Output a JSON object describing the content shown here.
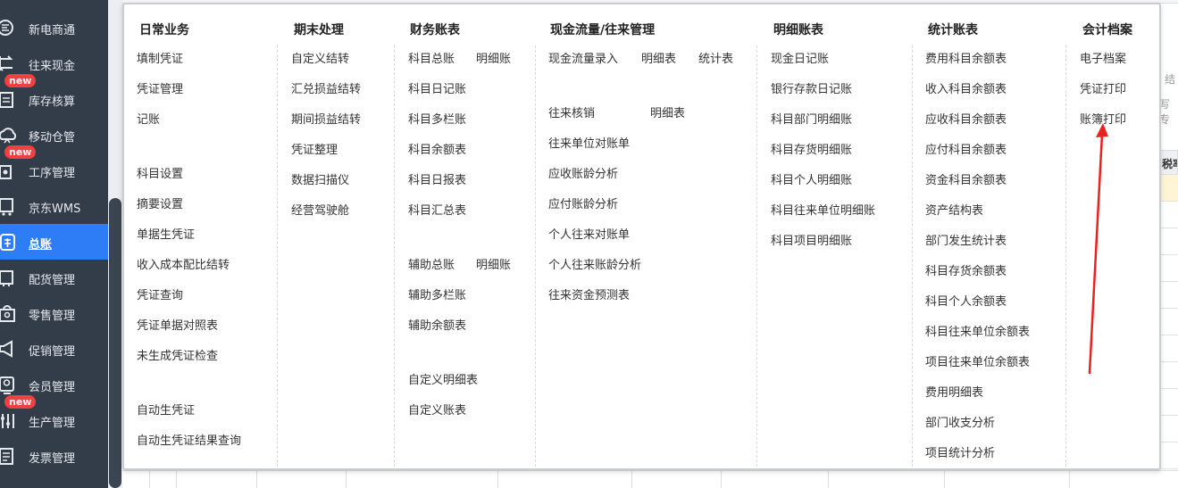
{
  "sidebar": {
    "items": [
      {
        "label": "新电商通",
        "icon": "ecommerce-icon",
        "badge": ""
      },
      {
        "label": "往来现金",
        "icon": "exchange-icon",
        "badge": ""
      },
      {
        "label": "库存核算",
        "icon": "inventory-icon",
        "badge": "new"
      },
      {
        "label": "移动仓管",
        "icon": "cloud-warehouse-icon",
        "badge": ""
      },
      {
        "label": "工序管理",
        "icon": "process-icon",
        "badge": "new"
      },
      {
        "label": "京东WMS",
        "icon": "wms-icon",
        "badge": ""
      },
      {
        "label": "总账",
        "icon": "ledger-icon",
        "badge": ""
      },
      {
        "label": "配货管理",
        "icon": "distribution-icon",
        "badge": ""
      },
      {
        "label": "零售管理",
        "icon": "retail-icon",
        "badge": ""
      },
      {
        "label": "促销管理",
        "icon": "promotion-icon",
        "badge": ""
      },
      {
        "label": "会员管理",
        "icon": "member-icon",
        "badge": ""
      },
      {
        "label": "生产管理",
        "icon": "production-icon",
        "badge": "new"
      },
      {
        "label": "发票管理",
        "icon": "invoice-icon",
        "badge": ""
      }
    ],
    "active_index": 6
  },
  "background": {
    "side_text_1": "结",
    "side_text_2": "写专",
    "table_header": "税率"
  },
  "menu": {
    "columns": [
      {
        "heading": "日常业务",
        "items": [
          "填制凭证",
          "凭证管理",
          "记账",
          "科目设置",
          "摘要设置",
          "单据生凭证",
          "收入成本配比结转",
          "凭证查询",
          "凭证单据对照表",
          "未生成凭证检查",
          "自动生凭证",
          "自动生凭证结果查询"
        ]
      },
      {
        "heading": "期末处理",
        "items": [
          "自定义结转",
          "汇兑损益结转",
          "期间损益结转",
          "凭证整理",
          "数据扫描仪",
          "经营驾驶舱"
        ]
      },
      {
        "heading": "财务账表",
        "items": [
          "科目总账",
          "明细账",
          "科目日记账",
          "科目多栏账",
          "科目余额表",
          "科目日报表",
          "科目汇总表",
          "辅助总账",
          "明细账",
          "辅助多栏账",
          "辅助余额表",
          "自定义明细表",
          "自定义账表"
        ]
      },
      {
        "heading": "现金流量/往来管理",
        "items": [
          "现金流量录入",
          "明细表",
          "统计表",
          "往来核销",
          "明细表",
          "往来单位对账单",
          "应收账龄分析",
          "应付账龄分析",
          "个人往来对账单",
          "个人往来账龄分析",
          "往来资金预测表"
        ]
      },
      {
        "heading": "明细账表",
        "items": [
          "现金日记账",
          "银行存款日记账",
          "科目部门明细账",
          "科目存货明细账",
          "科目个人明细账",
          "科目往来单位明细账",
          "科目项目明细账"
        ]
      },
      {
        "heading": "统计账表",
        "items": [
          "费用科目余额表",
          "收入科目余额表",
          "应收科目余额表",
          "应付科目余额表",
          "资金科目余额表",
          "资产结构表",
          "部门发生统计表",
          "科目存货余额表",
          "科目个人余额表",
          "科目往来单位余额表",
          "项目往来单位余额表",
          "费用明细表",
          "部门收支分析",
          "项目统计分析"
        ]
      },
      {
        "heading": "会计档案",
        "items": [
          "电子档案",
          "凭证打印",
          "账簿打印"
        ]
      }
    ]
  },
  "colors": {
    "sidebar_bg": "#333d4a",
    "active_bg": "#2f7df6",
    "badge": "#f04040",
    "arrow": "#e8221f"
  }
}
